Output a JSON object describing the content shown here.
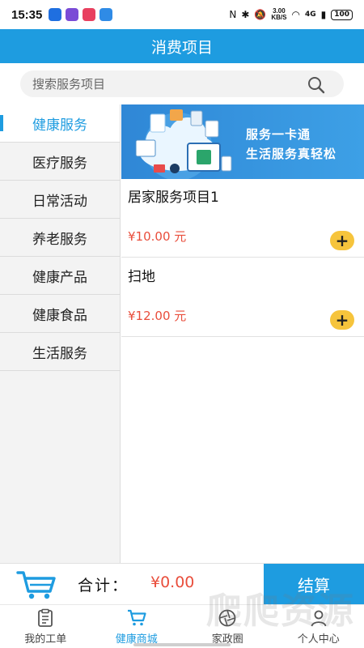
{
  "status_bar": {
    "time": "15:35",
    "speed_top": "3.00",
    "speed_bottom": "KB/S",
    "network": "4G",
    "battery": "100",
    "app_colors": [
      "#1f6fe0",
      "#7a4bd6",
      "#e8405f",
      "#2f8be6"
    ]
  },
  "header": {
    "title": "消费项目"
  },
  "search": {
    "placeholder": "搜索服务项目",
    "icon": "search-icon"
  },
  "sidebar": {
    "items": [
      {
        "label": "健康服务",
        "active": true
      },
      {
        "label": "医疗服务",
        "active": false
      },
      {
        "label": "日常活动",
        "active": false
      },
      {
        "label": "养老服务",
        "active": false
      },
      {
        "label": "健康产品",
        "active": false
      },
      {
        "label": "健康食品",
        "active": false
      },
      {
        "label": "生活服务",
        "active": false
      }
    ]
  },
  "banner": {
    "line1": "服务一卡通",
    "line2": "生活服务真轻松"
  },
  "products": [
    {
      "name": "居家服务项目1",
      "price": "¥10.00 元",
      "add": "+"
    },
    {
      "name": "扫地",
      "price": "¥12.00 元",
      "add": "+"
    }
  ],
  "cart": {
    "total_label": "合计：",
    "total_value": "¥0.00",
    "checkout_label": "结算"
  },
  "bottom_nav": {
    "items": [
      {
        "label": "我的工单",
        "icon": "clipboard-icon",
        "active": false
      },
      {
        "label": "健康商城",
        "icon": "cart-icon",
        "active": true
      },
      {
        "label": "家政圈",
        "icon": "aperture-icon",
        "active": false
      },
      {
        "label": "个人中心",
        "icon": "person-icon",
        "active": false
      }
    ]
  },
  "watermark": "爬爬资源",
  "colors": {
    "primary": "#1e9ce0",
    "price": "#e94e3c",
    "add_button": "#f6c43c"
  }
}
